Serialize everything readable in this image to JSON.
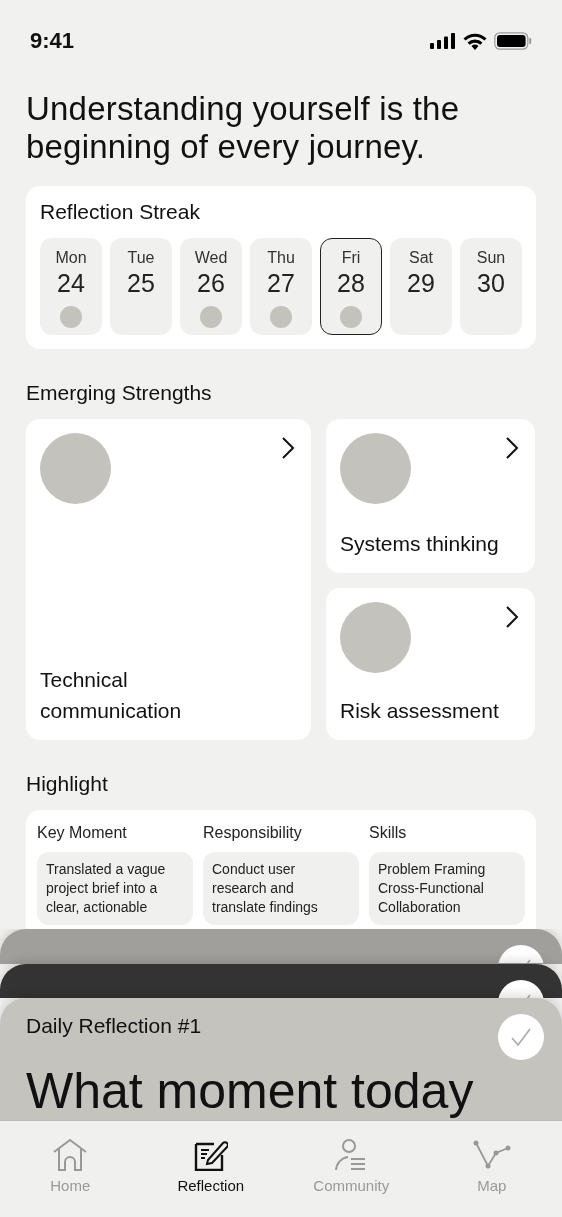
{
  "status_bar": {
    "time": "9:41"
  },
  "headline": "Understanding yourself is the beginning of every journey.",
  "streak": {
    "title": "Reflection Streak",
    "days": [
      {
        "day": "Mon",
        "date": "24",
        "done": true,
        "selected": false
      },
      {
        "day": "Tue",
        "date": "25",
        "done": false,
        "selected": false
      },
      {
        "day": "Wed",
        "date": "26",
        "done": true,
        "selected": false
      },
      {
        "day": "Thu",
        "date": "27",
        "done": true,
        "selected": false
      },
      {
        "day": "Fri",
        "date": "28",
        "done": true,
        "selected": true
      },
      {
        "day": "Sat",
        "date": "29",
        "done": false,
        "selected": false
      },
      {
        "day": "Sun",
        "date": "30",
        "done": false,
        "selected": false
      }
    ]
  },
  "strengths": {
    "title": "Emerging Strengths",
    "items": [
      {
        "label": "Technical communication"
      },
      {
        "label": "Systems thinking"
      },
      {
        "label": "Risk assessment"
      }
    ]
  },
  "highlight": {
    "title": "Highlight",
    "columns": [
      {
        "heading": "Key Moment",
        "text": "Translated a vague project brief into a clear, actionable"
      },
      {
        "heading": "Responsibility",
        "text": "Conduct user research and translate findings"
      },
      {
        "heading": "Skills",
        "text": "Problem Framing Cross-Functional Collaboration"
      }
    ]
  },
  "reflection_stack": [
    {
      "kind": "back",
      "checked": true
    },
    {
      "kind": "dark",
      "checked": true
    },
    {
      "kind": "front",
      "checked": true,
      "title": "Daily Reflection #1",
      "question": "What moment today"
    }
  ],
  "tabs": [
    {
      "label": "Home",
      "selected": false
    },
    {
      "label": "Reflection",
      "selected": true
    },
    {
      "label": "Community",
      "selected": false
    },
    {
      "label": "Map",
      "selected": false
    }
  ]
}
